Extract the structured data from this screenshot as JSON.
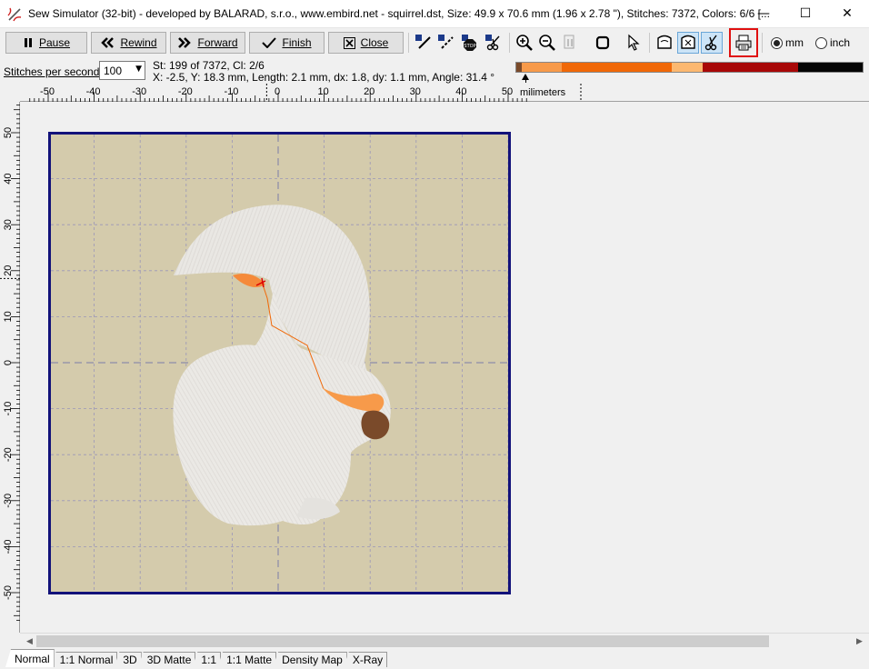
{
  "window": {
    "title": "Sew Simulator (32-bit) - developed by BALARAD, s.r.o., www.embird.net - squirrel.dst, Size: 49.9 x 70.6 mm (1.96 x 2.78 \"), Stitches: 7372, Colors: 6/6 [...",
    "minimize_glyph": "—",
    "maximize_glyph": "☐",
    "close_glyph": "✕"
  },
  "toolbar": {
    "pause_label": "Pause",
    "rewind_label": "Rewind",
    "forward_label": "Forward",
    "finish_label": "Finish",
    "close_label": "Close",
    "unit_mm_label": "mm",
    "unit_inch_label": "inch",
    "unit_selected": "mm",
    "icons": [
      "sew-single-icon",
      "sew-jump-icon",
      "stop-icon",
      "trim-icon",
      "zoom-in-icon",
      "zoom-out-icon",
      "zoom-1to1-icon",
      "fit-view-icon",
      "select-cursor-icon",
      "show-design-icon",
      "show-stitches-icon",
      "show-trims-icon",
      "print-icon"
    ]
  },
  "info": {
    "speed_label": "Stitches per second:",
    "speed_value": "100",
    "stitch_status": "St: 199 of 7372, Cl: 2/6",
    "position_status": "X: -2.5, Y: 18.3 mm, Length: 2.1 mm, dx: 1.8, dy: 1.1 mm, Angle: 31.4 °"
  },
  "color_sequence": [
    {
      "color": "#7a4a2a",
      "fraction": 0.015
    },
    {
      "color": "#f79a4a",
      "fraction": 0.116
    },
    {
      "color": "#f06808",
      "fraction": 0.317
    },
    {
      "color": "#fcb870",
      "fraction": 0.09
    },
    {
      "color": "#a80808",
      "fraction": 0.277
    },
    {
      "color": "#050505",
      "fraction": 0.185
    }
  ],
  "ruler": {
    "unit_label": "milimeters",
    "x_ticks": [
      "-50",
      "-40",
      "-30",
      "-20",
      "-10",
      "0",
      "10",
      "20",
      "30",
      "40",
      "50"
    ],
    "y_ticks": [
      "50",
      "40",
      "30",
      "20",
      "10",
      "0",
      "-10",
      "-20",
      "-30",
      "-40",
      "-50"
    ]
  },
  "view_tabs": [
    "Normal",
    "1:1 Normal",
    "3D",
    "3D Matte",
    "1:1",
    "1:1 Matte",
    "Density Map",
    "X-Ray"
  ],
  "active_tab": "Normal"
}
